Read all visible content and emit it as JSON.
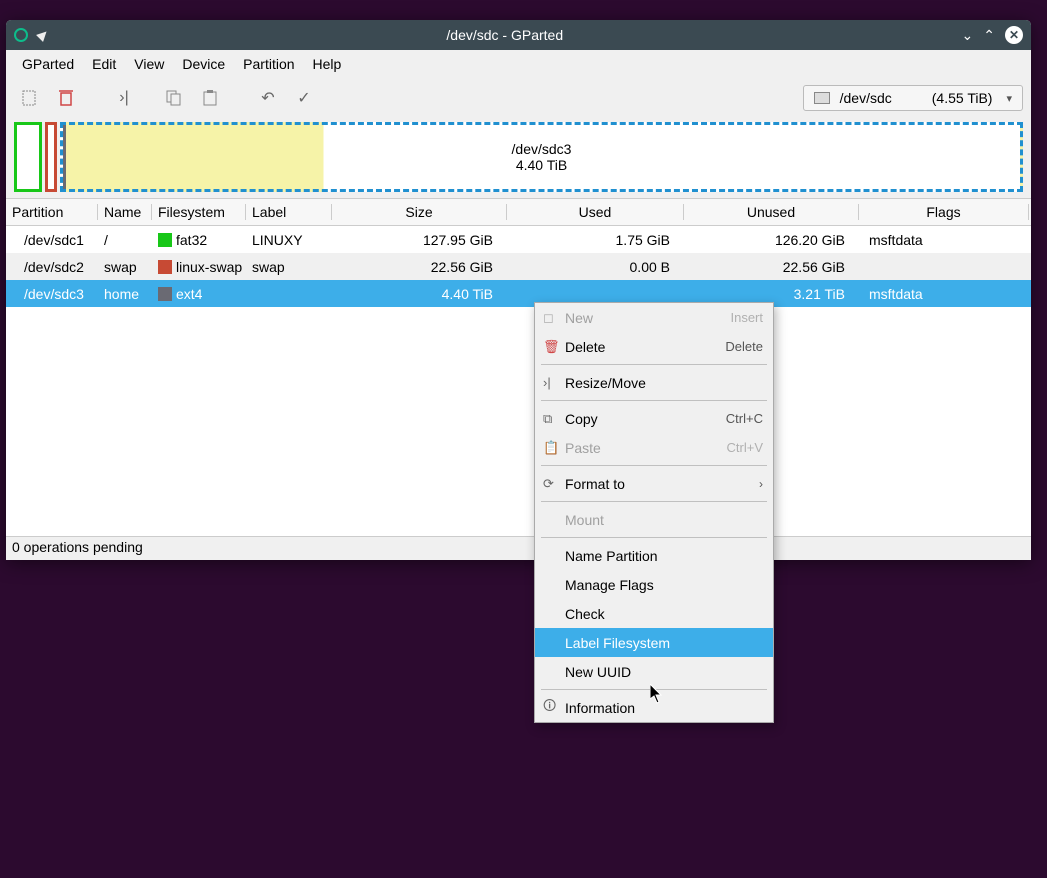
{
  "titlebar": {
    "title": "/dev/sdc - GParted"
  },
  "menubar": [
    "GParted",
    "Edit",
    "View",
    "Device",
    "Partition",
    "Help"
  ],
  "device_selector": {
    "path": "/dev/sdc",
    "size": "(4.55 TiB)"
  },
  "partmap_selected": {
    "name": "/dev/sdc3",
    "size": "4.40 TiB"
  },
  "columns": [
    "Partition",
    "Name",
    "Filesystem",
    "Label",
    "Size",
    "Used",
    "Unused",
    "Flags"
  ],
  "rows": [
    {
      "part": "/dev/sdc1",
      "name": "/",
      "fs": "fat32",
      "fs_color": "fs-fat32",
      "label": "LINUXY",
      "size": "127.95 GiB",
      "used": "1.75 GiB",
      "unused": "126.20 GiB",
      "flags": "msftdata"
    },
    {
      "part": "/dev/sdc2",
      "name": "swap",
      "fs": "linux-swap",
      "fs_color": "fs-swap",
      "label": "swap",
      "size": "22.56 GiB",
      "used": "0.00 B",
      "unused": "22.56 GiB",
      "flags": ""
    },
    {
      "part": "/dev/sdc3",
      "name": "home",
      "fs": "ext4",
      "fs_color": "fs-ext4",
      "label": "",
      "size": "4.40 TiB",
      "used": "",
      "unused": "3.21 TiB",
      "flags": "msftdata"
    }
  ],
  "status": "0 operations pending",
  "ctx": {
    "new": "New",
    "new_accel": "Insert",
    "delete": "Delete",
    "delete_accel": "Delete",
    "resize": "Resize/Move",
    "copy": "Copy",
    "copy_accel": "Ctrl+C",
    "paste": "Paste",
    "paste_accel": "Ctrl+V",
    "format": "Format to",
    "mount": "Mount",
    "namep": "Name Partition",
    "flags": "Manage Flags",
    "check": "Check",
    "labelfs": "Label Filesystem",
    "uuid": "New UUID",
    "info": "Information"
  }
}
